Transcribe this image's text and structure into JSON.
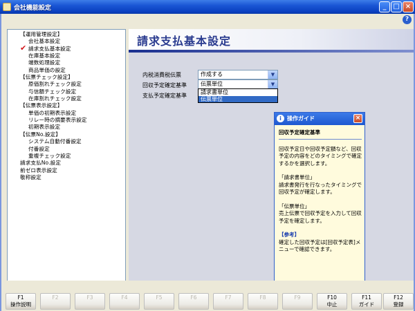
{
  "window": {
    "title": "会社機能設定",
    "minimize": "_",
    "maximize": "□",
    "close": "×"
  },
  "help_glyph": "?",
  "tree": {
    "items": [
      {
        "label": "【運用管理設定】",
        "level": "l0"
      },
      {
        "label": "会社基本設定",
        "level": "l1"
      },
      {
        "label": "請求支払基本設定",
        "level": "l1",
        "checked": true
      },
      {
        "label": "在庫基本設定",
        "level": "l1"
      },
      {
        "label": "端数処理設定",
        "level": "l1"
      },
      {
        "label": "商品単価の設定",
        "level": "l1"
      },
      {
        "label": "【伝票チェック設定】",
        "level": "l0"
      },
      {
        "label": "原価割れチェック設定",
        "level": "l1"
      },
      {
        "label": "与信額チェック設定",
        "level": "l1"
      },
      {
        "label": "在庫割れチェック設定",
        "level": "l1"
      },
      {
        "label": "【伝票表示設定】",
        "level": "l0"
      },
      {
        "label": "単価の初期表示設定",
        "level": "l1"
      },
      {
        "label": "リレー時の摘要表示設定",
        "level": "l1"
      },
      {
        "label": "初期表示設定",
        "level": "l1"
      },
      {
        "label": "【伝票No.設定】",
        "level": "l0"
      },
      {
        "label": "システム自動付番設定",
        "level": "l1"
      },
      {
        "label": "付番設定",
        "level": "l1"
      },
      {
        "label": "重複チェック設定",
        "level": "l1"
      },
      {
        "label": "請求支払No.設定",
        "level": "top"
      },
      {
        "label": "前ゼロ表示設定",
        "level": "top"
      },
      {
        "label": "敬称設定",
        "level": "top"
      }
    ],
    "check_glyph": "✔"
  },
  "main": {
    "title": "請求支払基本設定",
    "fields": [
      {
        "label": "内税消費税伝票",
        "value": "作成する"
      },
      {
        "label": "回収予定確定基準",
        "value": "伝票単位"
      },
      {
        "label": "支払予定確定基準",
        "value": ""
      }
    ],
    "dropdown_options": [
      "請求書単位",
      "伝票単位"
    ],
    "dropdown_selected": 1,
    "arrow_glyph": "▼"
  },
  "guide": {
    "title": "操作ガイド",
    "info_glyph": "i",
    "close_glyph": "×",
    "heading": "回収予定確定基準",
    "paragraphs": [
      "回収予定日や回収予定額など、回収予定の内容をどのタイミングで確定するかを選択します。",
      "「請求書単位」\n請求書発行を行なったタイミングで回収予定が確定します。",
      "「伝票単位」\n売上伝票で回収予定を入力して回収予定を確定します。"
    ],
    "reference_title": "【参考】",
    "reference_text": "確定した回収予定は[回収予定表]メニューで確認できます。"
  },
  "fkeys": [
    {
      "name": "F1",
      "label": "操作説明",
      "enabled": true
    },
    {
      "name": "F2",
      "label": "",
      "enabled": false
    },
    {
      "name": "F3",
      "label": "",
      "enabled": false
    },
    {
      "name": "F4",
      "label": "",
      "enabled": false
    },
    {
      "name": "F5",
      "label": "",
      "enabled": false
    },
    {
      "name": "F6",
      "label": "",
      "enabled": false
    },
    {
      "name": "F7",
      "label": "",
      "enabled": false
    },
    {
      "name": "F8",
      "label": "",
      "enabled": false
    },
    {
      "name": "F9",
      "label": "",
      "enabled": false
    },
    {
      "name": "F10",
      "label": "中止",
      "enabled": true
    },
    {
      "name": "F11",
      "label": "ガイド",
      "enabled": true
    },
    {
      "name": "F12",
      "label": "登録",
      "enabled": true
    }
  ]
}
